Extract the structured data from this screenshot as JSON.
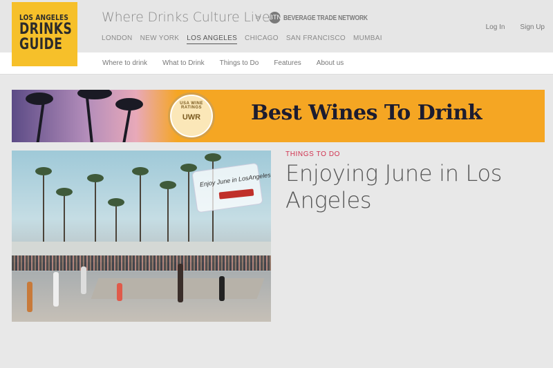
{
  "logo": {
    "line1": "LOS ANGELES",
    "line2": "DRINKS",
    "line3": "GUIDE",
    "color": "#f6c02a"
  },
  "header": {
    "tagline": "Where Drinks Culture Lives",
    "by": "by",
    "partner_icon": "BTN",
    "partner": "BEVERAGE TRADE NETWORK"
  },
  "cities": [
    "LONDON",
    "NEW YORK",
    "LOS ANGELES",
    "CHICAGO",
    "SAN FRANCISCO",
    "MUMBAI"
  ],
  "active_city": "LOS ANGELES",
  "auth": {
    "login": "Log In",
    "signup": "Sign Up"
  },
  "subnav": [
    "Where to drink",
    "What to Drink",
    "Things to Do",
    "Features",
    "About us"
  ],
  "banner": {
    "seal_top": "USA WINE RATINGS",
    "seal_mid": "UWR",
    "headline": "Best Wines To Drink",
    "bg_color": "#f5a623"
  },
  "article": {
    "image_sign": "Enjoy June in LosAngeles",
    "category": "THINGS TO DO",
    "category_color": "#d0314f",
    "title": "Enjoying June in Los Angeles"
  }
}
